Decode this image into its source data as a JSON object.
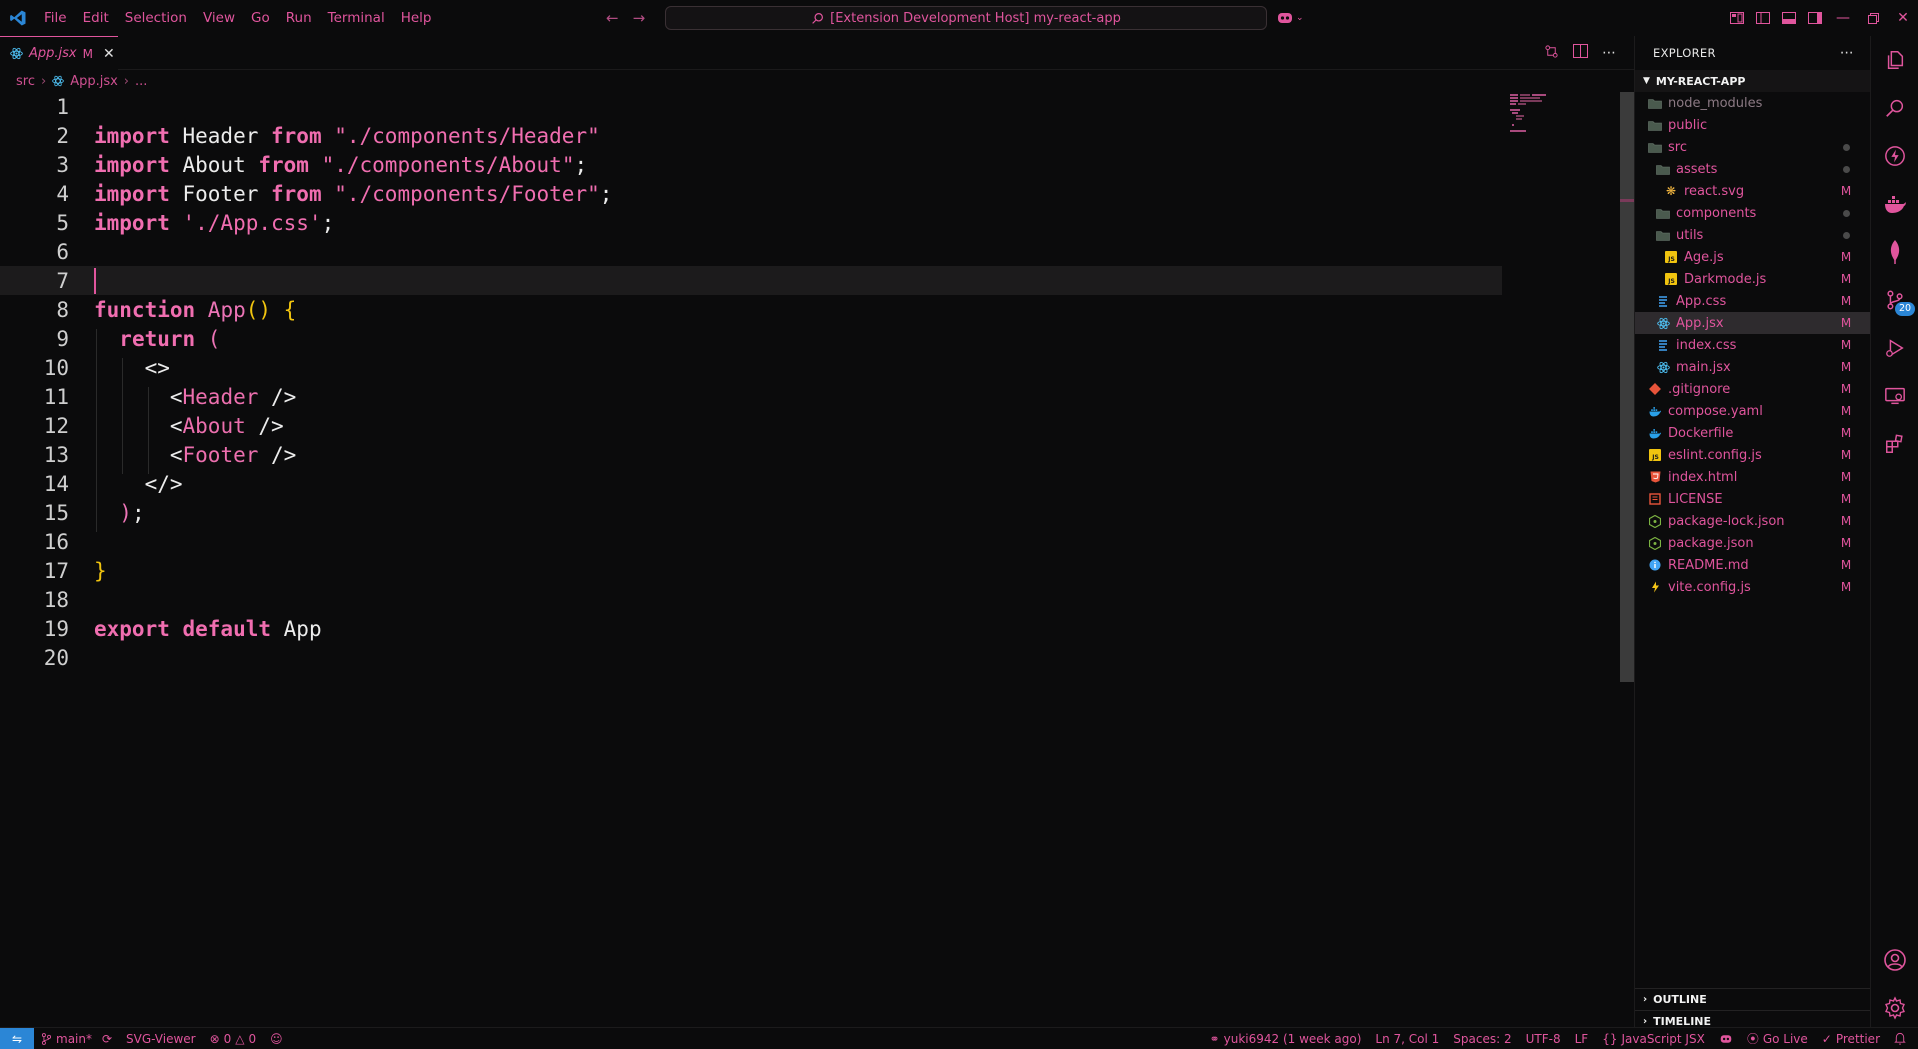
{
  "menu": [
    "File",
    "Edit",
    "Selection",
    "View",
    "Go",
    "Run",
    "Terminal",
    "Help"
  ],
  "command_center": "[Extension Development Host] my-react-app",
  "tab": {
    "name": "App.jsx",
    "modified": "M"
  },
  "breadcrumb": {
    "folder": "src",
    "file": "App.jsx",
    "more": "..."
  },
  "editor": {
    "cursor_line": 7,
    "lines": [
      {
        "n": "1"
      },
      {
        "n": "2"
      },
      {
        "n": "3"
      },
      {
        "n": "4"
      },
      {
        "n": "5"
      },
      {
        "n": "6"
      },
      {
        "n": "7"
      },
      {
        "n": "8"
      },
      {
        "n": "9"
      },
      {
        "n": "10"
      },
      {
        "n": "11"
      },
      {
        "n": "12"
      },
      {
        "n": "13"
      },
      {
        "n": "14"
      },
      {
        "n": "15"
      },
      {
        "n": "16"
      },
      {
        "n": "17"
      },
      {
        "n": "18"
      },
      {
        "n": "19"
      },
      {
        "n": "20"
      }
    ],
    "code": {
      "l2": {
        "kw1": "import",
        "id": " Header ",
        "kw2": "from",
        "str": " \"./components/Header\""
      },
      "l3": {
        "kw1": "import",
        "id": " About ",
        "kw2": "from",
        "str": " \"./components/About\"",
        "end": ";"
      },
      "l4": {
        "kw1": "import",
        "id": " Footer ",
        "kw2": "from",
        "str": " \"./components/Footer\"",
        "end": ";"
      },
      "l5": {
        "kw1": "import",
        "str": " './App.css'",
        "end": ";"
      },
      "l8": {
        "kw": "function",
        "name": " App",
        "paren": "()",
        "brace": " {"
      },
      "l9": {
        "kw": "return",
        "paren": " ("
      },
      "l10": {
        "text": "<>"
      },
      "l11": {
        "open": "<",
        "tag": "Header",
        "close": " />"
      },
      "l12": {
        "open": "<",
        "tag": "About",
        "close": " />"
      },
      "l13": {
        "open": "<",
        "tag": "Footer",
        "close": " />"
      },
      "l14": {
        "text": "</>"
      },
      "l15": {
        "paren": ")",
        "end": ";"
      },
      "l17": {
        "brace": "}"
      },
      "l19": {
        "kw1": "export",
        "kw2": " default",
        "id": " App"
      }
    }
  },
  "explorer": {
    "title": "EXPLORER",
    "root": "MY-REACT-APP",
    "items": [
      {
        "label": "node_modules",
        "level": 0,
        "icon": "folder-icon",
        "status": ""
      },
      {
        "label": "public",
        "level": 0,
        "icon": "folder-icon",
        "status": ""
      },
      {
        "label": "src",
        "level": 0,
        "icon": "folder-icon",
        "status": "dot"
      },
      {
        "label": "assets",
        "level": 1,
        "icon": "folder-icon",
        "status": "dot"
      },
      {
        "label": "react.svg",
        "level": 2,
        "icon": "svg-icon",
        "status": "M"
      },
      {
        "label": "components",
        "level": 1,
        "icon": "folder-icon",
        "status": "dot"
      },
      {
        "label": "utils",
        "level": 1,
        "icon": "folder-icon",
        "status": "dot"
      },
      {
        "label": "Age.js",
        "level": 2,
        "icon": "js-icon",
        "status": "M"
      },
      {
        "label": "Darkmode.js",
        "level": 2,
        "icon": "js-icon",
        "status": "M"
      },
      {
        "label": "App.css",
        "level": 1,
        "icon": "css-icon",
        "status": "M"
      },
      {
        "label": "App.jsx",
        "level": 1,
        "icon": "react-icon",
        "status": "M",
        "selected": true
      },
      {
        "label": "index.css",
        "level": 1,
        "icon": "css-icon",
        "status": "M"
      },
      {
        "label": "main.jsx",
        "level": 1,
        "icon": "react-icon",
        "status": "M"
      },
      {
        "label": ".gitignore",
        "level": 0,
        "icon": "git-icon",
        "status": "M"
      },
      {
        "label": "compose.yaml",
        "level": 0,
        "icon": "docker-icon",
        "status": "M"
      },
      {
        "label": "Dockerfile",
        "level": 0,
        "icon": "docker-icon",
        "status": "M"
      },
      {
        "label": "eslint.config.js",
        "level": 0,
        "icon": "js-icon",
        "status": "M"
      },
      {
        "label": "index.html",
        "level": 0,
        "icon": "html-icon",
        "status": "M"
      },
      {
        "label": "LICENSE",
        "level": 0,
        "icon": "license-icon",
        "status": "M"
      },
      {
        "label": "package-lock.json",
        "level": 0,
        "icon": "node-icon",
        "status": "M"
      },
      {
        "label": "package.json",
        "level": 0,
        "icon": "node-icon",
        "status": "M"
      },
      {
        "label": "README.md",
        "level": 0,
        "icon": "info-icon",
        "status": "M"
      },
      {
        "label": "vite.config.js",
        "level": 0,
        "icon": "vite-icon",
        "status": "M"
      }
    ],
    "outline": "OUTLINE",
    "timeline": "TIMELINE"
  },
  "activity": {
    "source_control_badge": "20"
  },
  "status": {
    "branch": "main*",
    "svg_viewer": "SVG-Viewer",
    "errors": "0",
    "warnings": "0",
    "blame": "yuki6942 (1 week ago)",
    "position": "Ln 7, Col 1",
    "spaces": "Spaces: 2",
    "encoding": "UTF-8",
    "eol": "LF",
    "language": "JavaScript JSX",
    "go_live": "Go Live",
    "prettier": "Prettier"
  },
  "colors": {
    "accent": "#e0559d",
    "remote": "#2b86d6",
    "background": "#0b0b0c"
  }
}
